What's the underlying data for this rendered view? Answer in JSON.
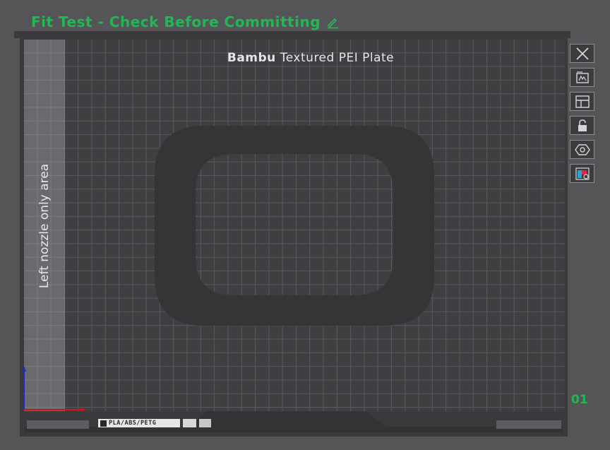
{
  "project": {
    "title": "Fit Test - Check Before Committing"
  },
  "plate": {
    "brand": "Bambu",
    "name": "Textured PEI Plate",
    "left_zone_label": "Left nozzle only area",
    "filament_tag": "PLA/ABS/PETG",
    "index": "01"
  },
  "toolbar": {
    "items": [
      {
        "icon": "close-icon"
      },
      {
        "icon": "auto-orient-icon"
      },
      {
        "icon": "arrange-icon"
      },
      {
        "icon": "lock-icon"
      },
      {
        "icon": "settings-icon"
      },
      {
        "icon": "filament-color-icon"
      }
    ]
  },
  "colors": {
    "accent": "#1fb954",
    "background": "#555558",
    "plate": "#3f3f42",
    "model": "#353537",
    "x_axis": "#d01515",
    "y_axis": "#1a2cc8"
  }
}
